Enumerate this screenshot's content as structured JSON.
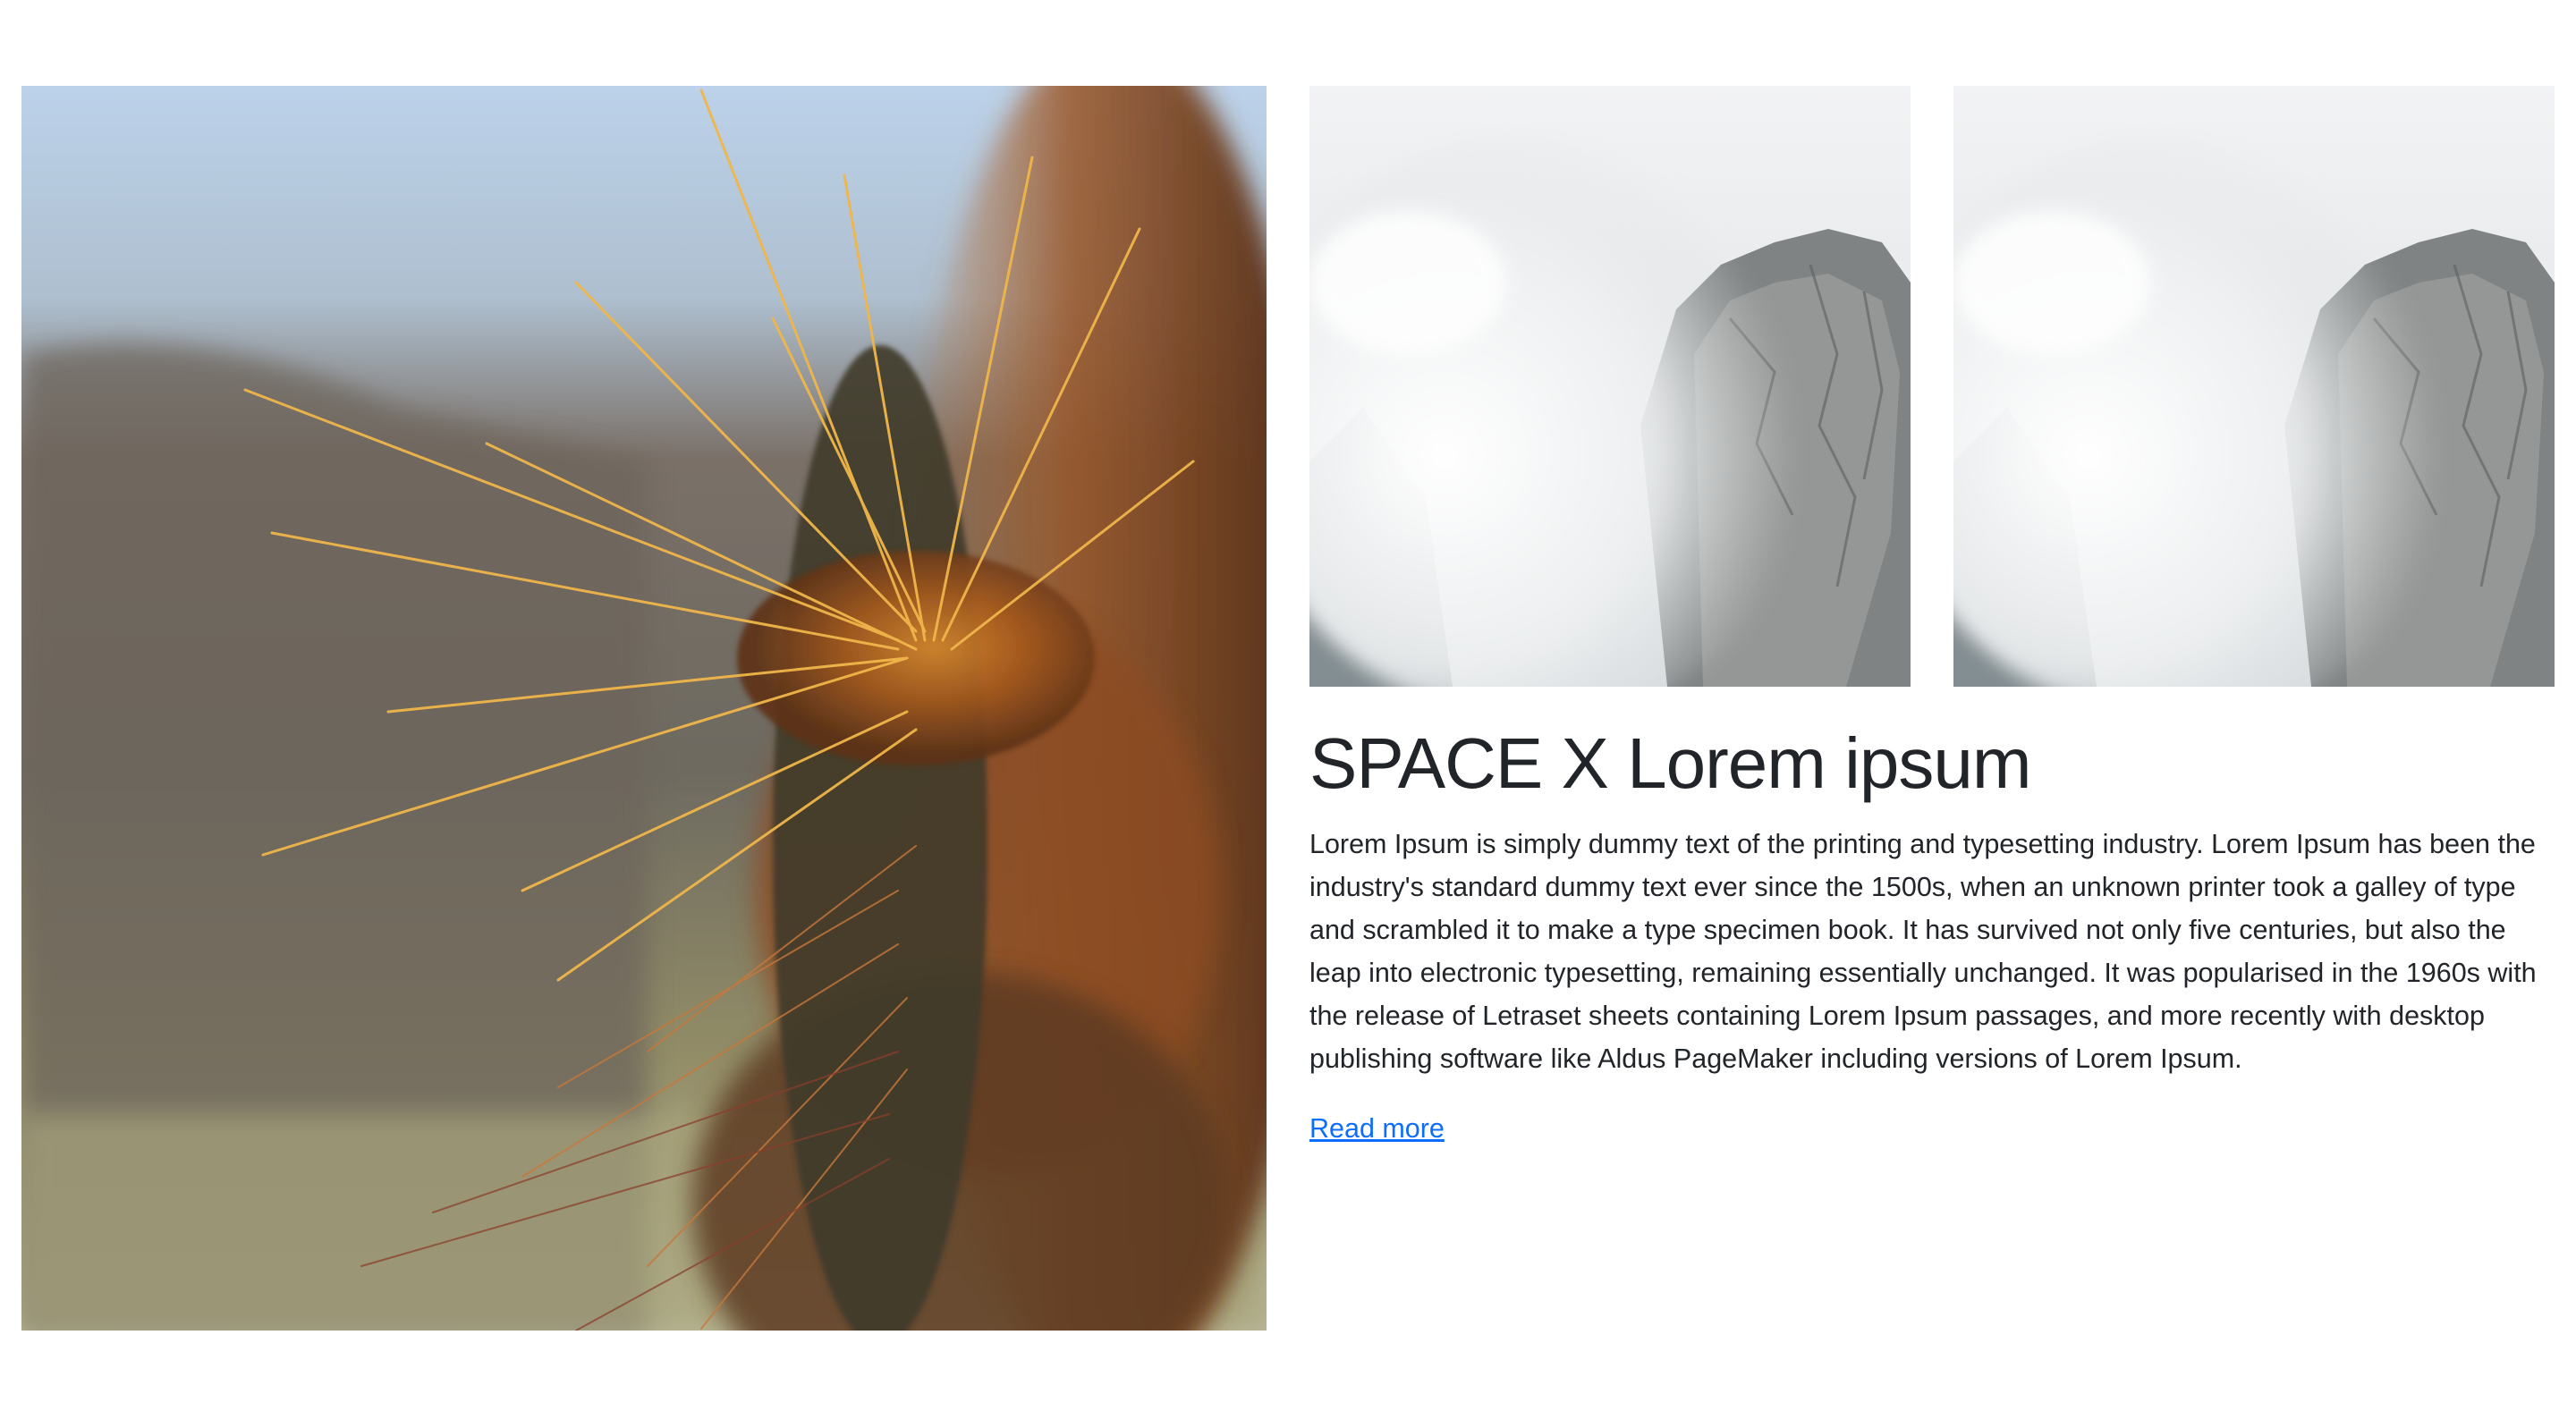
{
  "hero": {
    "image": "cactus-closeup-photo"
  },
  "gallery": {
    "images": [
      "mountain-clouds-photo",
      "mountain-clouds-photo"
    ]
  },
  "article": {
    "title": "SPACE X Lorem ipsum",
    "body": "Lorem Ipsum is simply dummy text of the printing and typesetting industry. Lorem Ipsum has been the industry's standard dummy text ever since the 1500s, when an unknown printer took a galley of type and scrambled it to make a type specimen book. It has survived not only five centuries, but also the leap into electronic typesetting, remaining essentially unchanged. It was popularised in the 1960s with the release of Letraset sheets containing Lorem Ipsum passages, and more recently with desktop publishing software like Aldus PageMaker including versions of Lorem Ipsum.",
    "read_more_label": "Read more"
  },
  "colors": {
    "text": "#212529",
    "link": "#0d6efd",
    "background": "#ffffff"
  }
}
